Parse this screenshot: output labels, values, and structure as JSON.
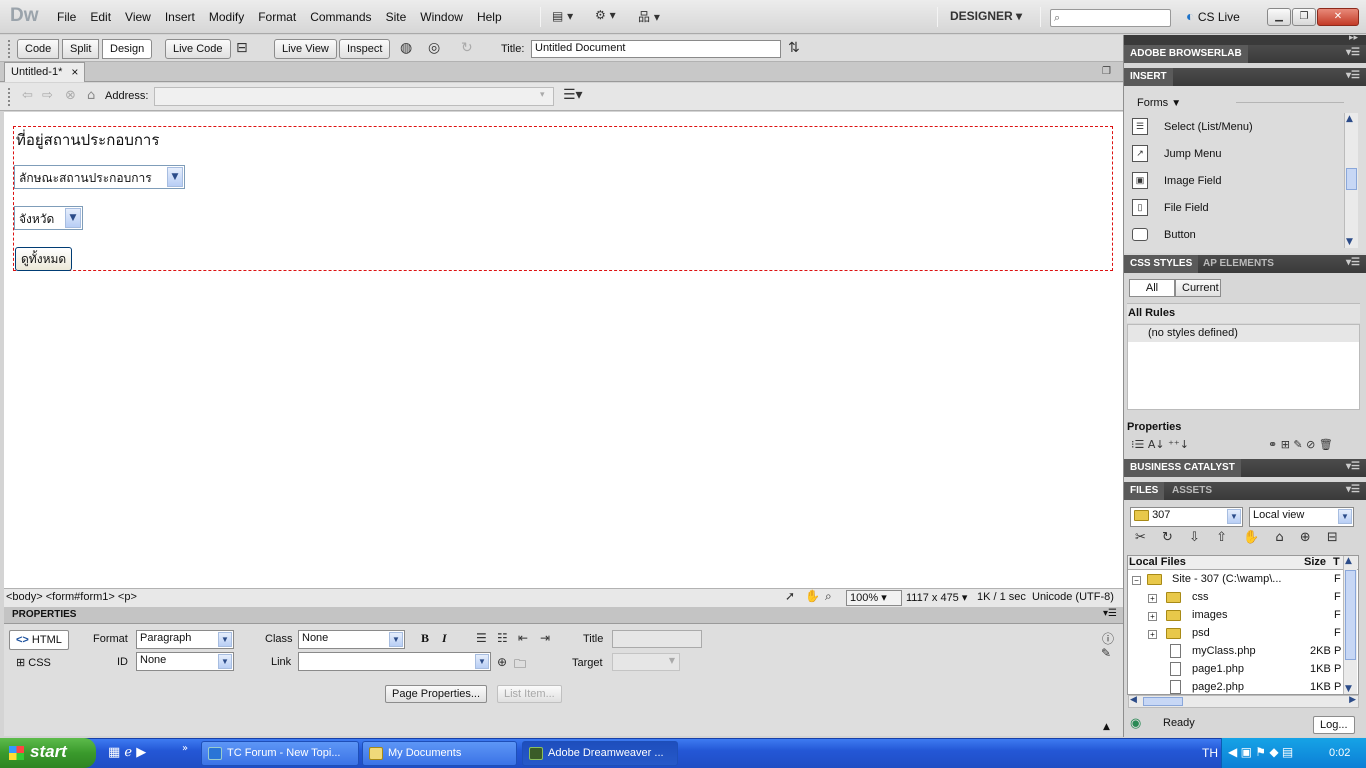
{
  "app": {
    "logo": "Dw",
    "workspace": "DESIGNER",
    "cs_live": "CS Live"
  },
  "menu": [
    "File",
    "Edit",
    "View",
    "Insert",
    "Modify",
    "Format",
    "Commands",
    "Site",
    "Window",
    "Help"
  ],
  "doc_toolbar": {
    "view_buttons": [
      "Code",
      "Split",
      "Design"
    ],
    "active_view": "Design",
    "live_code": "Live Code",
    "live_view": "Live View",
    "inspect": "Inspect",
    "title_label": "Title:",
    "title_value": "Untitled Document"
  },
  "document_tab": {
    "label": "Untitled-1*"
  },
  "address_bar": {
    "label": "Address:",
    "value": ""
  },
  "canvas": {
    "heading": "ที่อยู่สถานประกอบการ",
    "select_type": "ลักษณะสถานประกอบการ",
    "select_province": "จังหวัด",
    "button_view_all": "ดูทั้งหมด"
  },
  "status_bar": {
    "tag_selector": "<body> <form#form1> <p>",
    "zoom": "100%",
    "dimensions": "1117 x 475",
    "download": "1K / 1 sec",
    "encoding": "Unicode (UTF-8)"
  },
  "properties": {
    "header": "PROPERTIES",
    "html_btn": "HTML",
    "css_btn": "CSS",
    "format_label": "Format",
    "format_value": "Paragraph",
    "id_label": "ID",
    "id_value": "None",
    "class_label": "Class",
    "class_value": "None",
    "link_label": "Link",
    "link_value": "",
    "bold": "B",
    "italic": "I",
    "title_label": "Title",
    "target_label": "Target",
    "page_properties": "Page Properties...",
    "list_item": "List Item..."
  },
  "panels": {
    "browserlab": "ADOBE BROWSERLAB",
    "insert": "INSERT",
    "insert_category": "Forms",
    "insert_items": [
      "Select (List/Menu)",
      "Jump Menu",
      "Image Field",
      "File Field",
      "Button"
    ],
    "css_styles_tab": "CSS STYLES",
    "ap_elements_tab": "AP ELEMENTS",
    "css_all": "All",
    "css_current": "Current",
    "all_rules": "All Rules",
    "no_styles": "(no styles defined)",
    "properties": "Properties",
    "business_catalyst": "BUSINESS CATALYST",
    "files_tab": "FILES",
    "assets_tab": "ASSETS",
    "site_select": "307",
    "view_select": "Local view",
    "files_headers": [
      "Local Files",
      "Size",
      "T"
    ],
    "files_rows": [
      {
        "name": "Site - 307 (C:\\wamp\\...",
        "size": "",
        "type": "F"
      },
      {
        "name": "css",
        "size": "",
        "type": "F"
      },
      {
        "name": "images",
        "size": "",
        "type": "F"
      },
      {
        "name": "psd",
        "size": "",
        "type": "F"
      },
      {
        "name": "myClass.php",
        "size": "2KB",
        "type": "P"
      },
      {
        "name": "page1.php",
        "size": "1KB",
        "type": "P"
      },
      {
        "name": "page2.php",
        "size": "1KB",
        "type": "P"
      }
    ],
    "ready": "Ready",
    "log": "Log..."
  },
  "taskbar": {
    "start": "start",
    "tasks": [
      "TC Forum - New Topi...",
      "My Documents",
      "Adobe Dreamweaver ..."
    ],
    "lang": "TH",
    "time": "0:02"
  },
  "colors": {
    "form_outline": "#dd1111",
    "panel_header": "#444444",
    "taskbar": "#245edb",
    "start": "#3a9a2c"
  }
}
